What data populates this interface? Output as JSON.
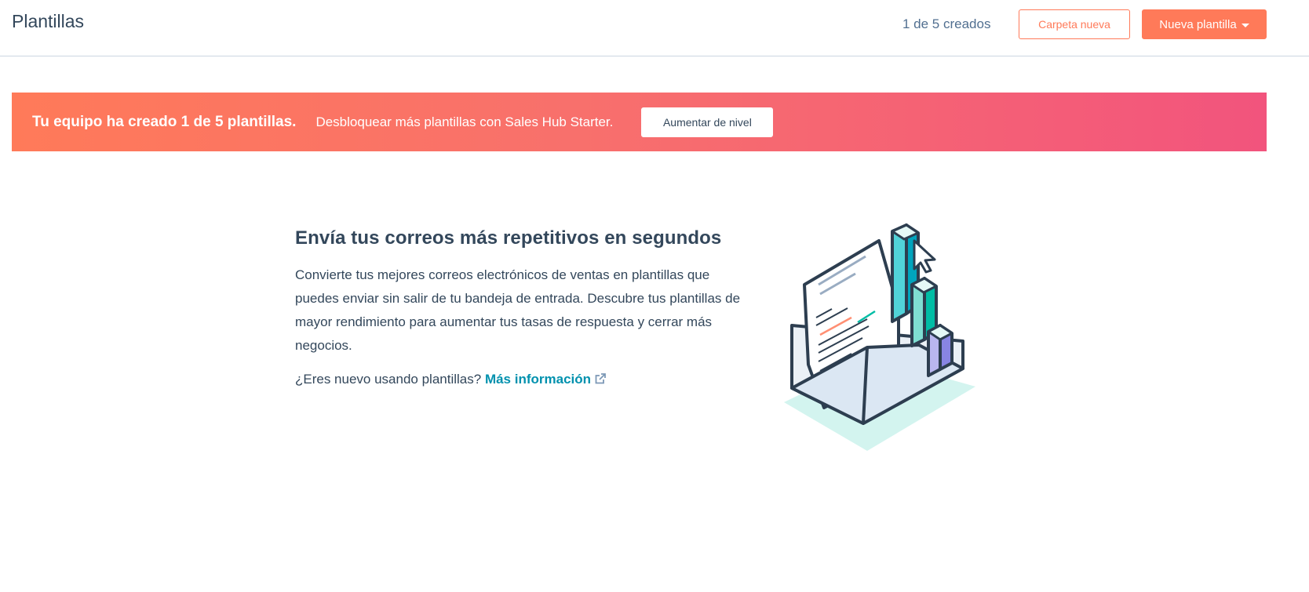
{
  "header": {
    "title": "Plantillas",
    "created_count": "1 de 5 creados",
    "new_folder_label": "Carpeta nueva",
    "new_template_label": "Nueva plantilla"
  },
  "banner": {
    "strong_text": "Tu equipo ha creado 1 de 5 plantillas.",
    "text": "Desbloquear más plantillas con Sales Hub Starter.",
    "button_label": "Aumentar de nivel",
    "colors": {
      "start": "#ff7a59",
      "end": "#f2547d"
    }
  },
  "empty_state": {
    "heading": "Envía tus correos más repetitivos en segundos",
    "description": "Convierte tus mejores correos electrónicos de ventas en plantillas que puedes enviar sin salir de tu bandeja de entrada. Descubre tus plantillas de mayor rendimiento para aumentar tus tasas de respuesta y cerrar más negocios.",
    "learn_prefix": "¿Eres nuevo usando plantillas?",
    "learn_link": "Más información",
    "illustration_icon": "envelope-chart-illustration"
  },
  "colors": {
    "accent": "#ff7a59",
    "text": "#33475b",
    "link": "#0091ae"
  }
}
